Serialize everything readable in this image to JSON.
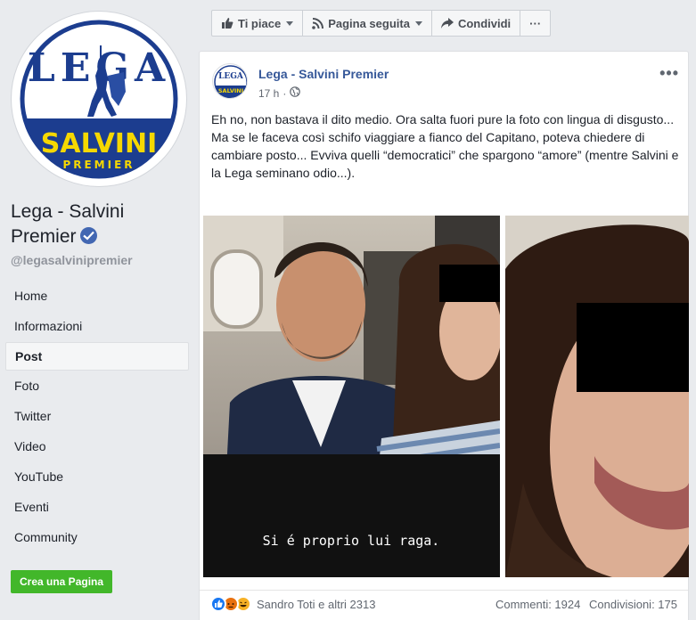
{
  "page": {
    "name": "Lega - Salvini Premier",
    "handle": "@legasalvinipremier",
    "logo_text": {
      "top": "LEGA",
      "middle": "SALVINI",
      "bottom": "PREMIER"
    }
  },
  "sidebar": {
    "items": [
      {
        "label": "Home"
      },
      {
        "label": "Informazioni"
      },
      {
        "label": "Post"
      },
      {
        "label": "Foto"
      },
      {
        "label": "Twitter"
      },
      {
        "label": "Video"
      },
      {
        "label": "YouTube"
      },
      {
        "label": "Eventi"
      },
      {
        "label": "Community"
      }
    ],
    "active_index": 2,
    "create_page_label": "Crea una Pagina"
  },
  "toolbar": {
    "like_label": "Ti piace",
    "follow_label": "Pagina seguita",
    "share_label": "Condividi",
    "more_label": "···"
  },
  "post": {
    "author": "Lega - Salvini Premier",
    "time": "17 h",
    "more_label": "•••",
    "text_lines": [
      "Eh no, non bastava il dito medio. Ora salta fuori pure la foto con lingua di disgusto...",
      "Ma se le faceva così schifo viaggiare a fianco del Capitano, poteva chiedere di cambiare posto... Evviva quelli “democratici” che spargono “amore” (mentre Salvini e la Lega seminano odio...)."
    ],
    "photo_caption": "Si é proprio lui raga.",
    "reactions_text": "Sandro Toti e altri 2313",
    "comments": "Commenti: 1924",
    "shares": "Condivisioni: 175"
  },
  "colors": {
    "link_blue": "#365899",
    "brand_blue": "#4267b2",
    "create_green": "#42b72a",
    "lega_blue": "#1c3d8f",
    "lega_yellow": "#f6d800"
  },
  "icons": {
    "verified": "verified-badge-icon",
    "like": "thumbs-up-icon",
    "follow": "rss-icon",
    "share": "share-arrow-icon",
    "globe": "globe-icon"
  }
}
